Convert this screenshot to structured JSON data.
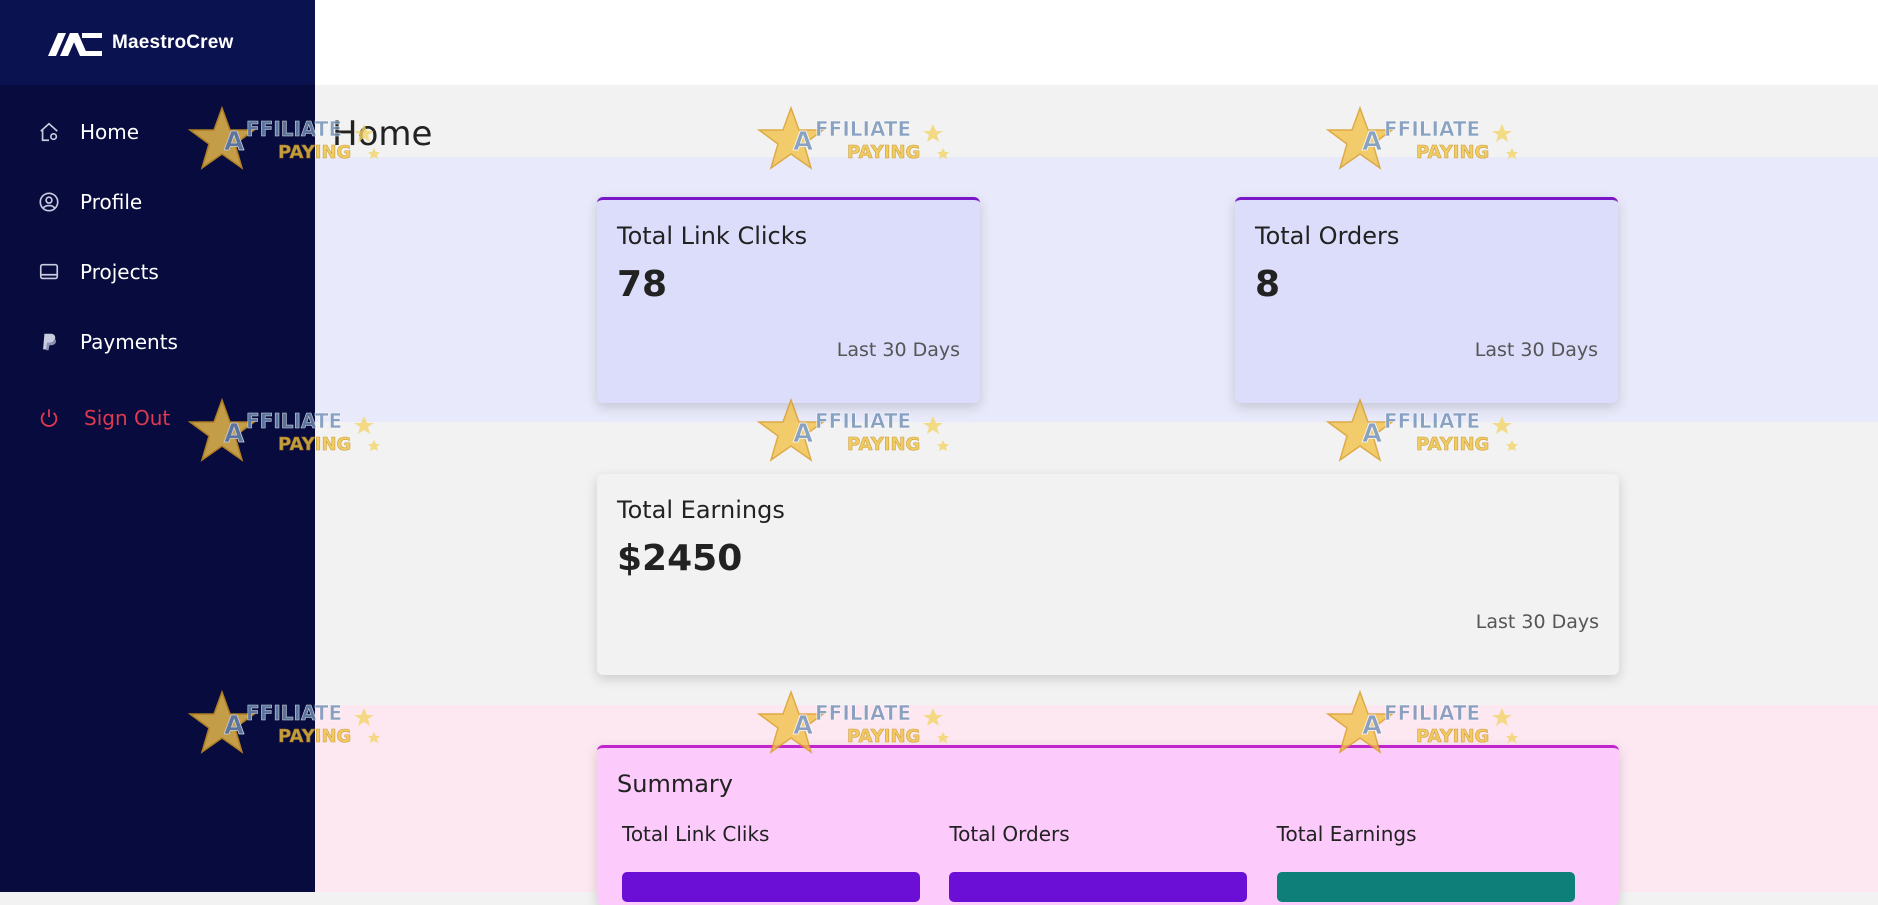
{
  "brand": {
    "name": "MaestroCrew"
  },
  "sidebar": {
    "items": [
      {
        "label": "Home",
        "icon": "home-icon"
      },
      {
        "label": "Profile",
        "icon": "user-circle-icon"
      },
      {
        "label": "Projects",
        "icon": "monitor-icon"
      },
      {
        "label": "Payments",
        "icon": "paypal-icon"
      }
    ],
    "signout": {
      "label": "Sign Out",
      "icon": "power-icon"
    }
  },
  "page": {
    "title": "Home"
  },
  "cards": {
    "clicks": {
      "title": "Total Link Clicks",
      "value": "78",
      "sub": "Last 30 Days"
    },
    "orders": {
      "title": "Total Orders",
      "value": "8",
      "sub": "Last 30 Days"
    },
    "earnings": {
      "title": "Total Earnings",
      "value": "$2450",
      "sub": "Last 30 Days"
    }
  },
  "summary": {
    "title": "Summary",
    "columns": [
      {
        "label": "Total Link Cliks",
        "color": "#6c0fd6"
      },
      {
        "label": "Total Orders",
        "color": "#6c0fd6"
      },
      {
        "label": "Total Earnings",
        "color": "#0e7f79"
      }
    ]
  },
  "colors": {
    "sidebar": "#070b3d",
    "accent_purple": "#7a18c9",
    "signout": "#e0394f",
    "summary_accent": "#c124cf"
  },
  "watermark": {
    "line1": "AFFILIATE",
    "line2": "PAYING"
  }
}
